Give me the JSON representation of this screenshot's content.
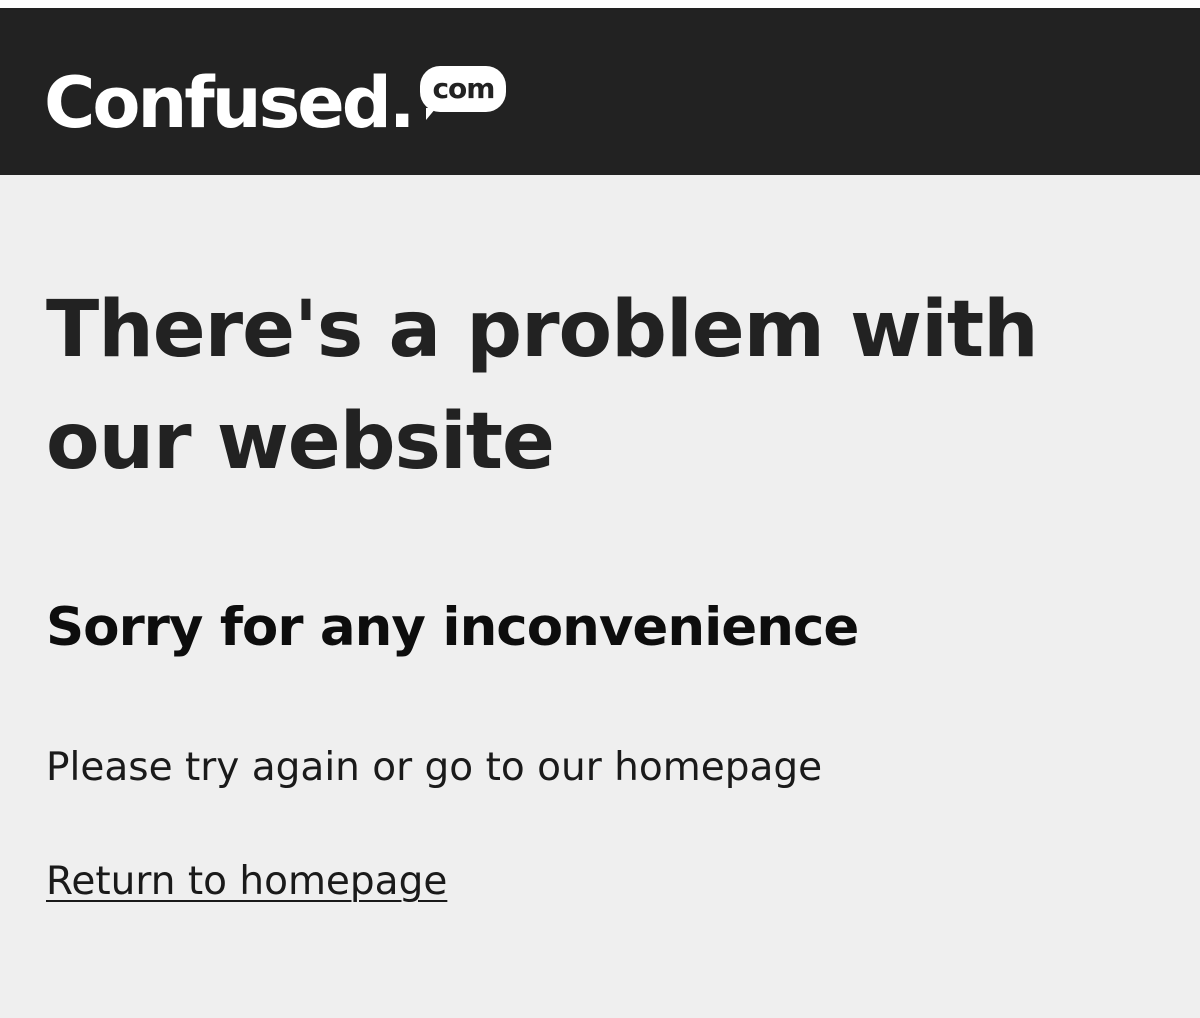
{
  "header": {
    "logo_word": "Confused.",
    "logo_bubble": "com",
    "background": "#222222"
  },
  "main": {
    "title": "There's a problem with our website",
    "subtitle": "Sorry for any inconvenience",
    "body": "Please try again or go to our homepage",
    "link_label": "Return to homepage"
  },
  "colors": {
    "page_background": "#efefef",
    "text": "#222222"
  }
}
